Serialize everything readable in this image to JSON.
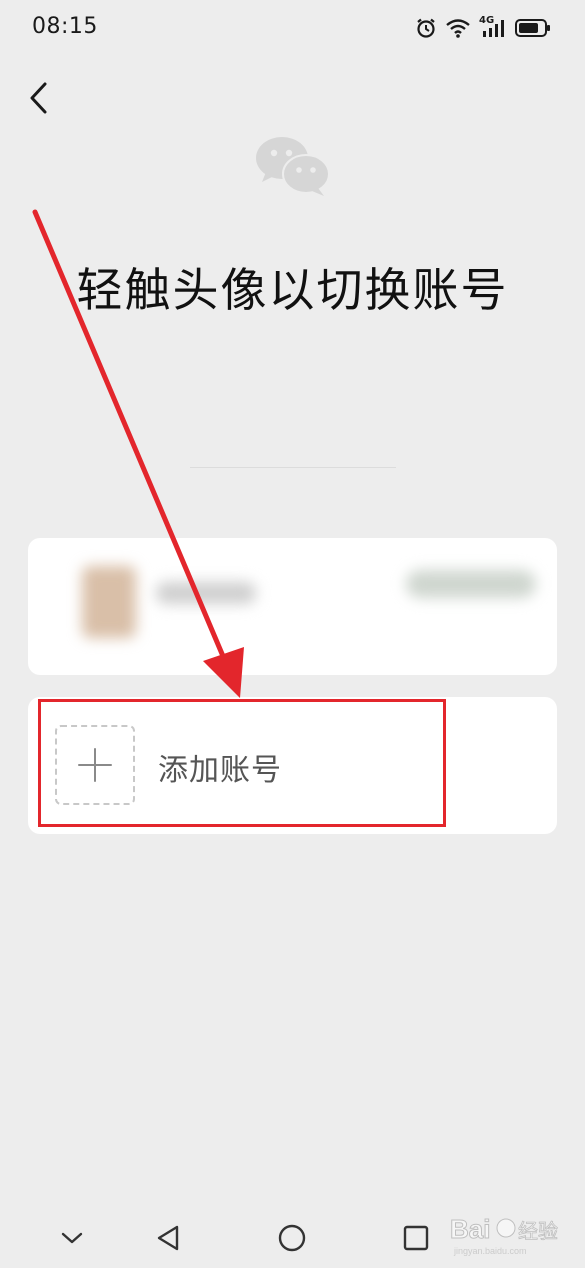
{
  "status_bar": {
    "time": "08:15",
    "icons": [
      "alarm-icon",
      "wifi-icon",
      "signal-4g-icon",
      "battery-icon"
    ],
    "network_label": "4G"
  },
  "header": {
    "back_icon": "chevron-left-icon",
    "logo": "wechat-logo"
  },
  "main": {
    "headline": "轻触头像以切换账号"
  },
  "accounts": {
    "add_label": "添加账号",
    "add_icon": "plus-icon"
  },
  "nav_bar": {
    "icons": [
      "chevron-down-icon",
      "back-triangle-icon",
      "home-circle-icon",
      "recents-square-icon"
    ]
  },
  "watermark": {
    "text": "Bai 经验"
  },
  "colors": {
    "background": "#ededed",
    "card": "#ffffff",
    "annotation_red": "#e3262c",
    "logo_gray": "#d6d6d6"
  }
}
